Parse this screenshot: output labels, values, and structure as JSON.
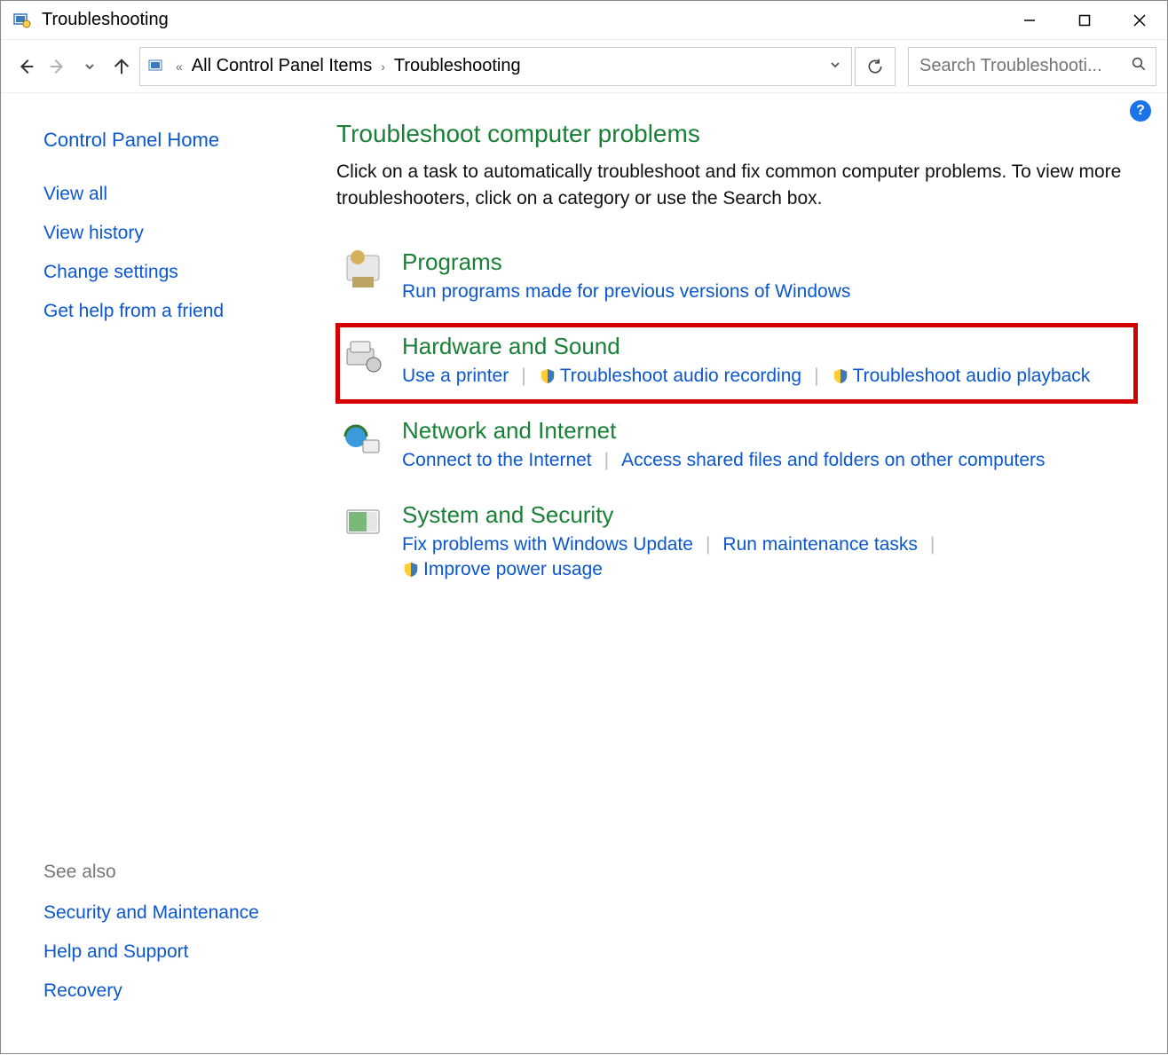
{
  "window": {
    "title": "Troubleshooting"
  },
  "breadcrumb": {
    "item1": "All Control Panel Items",
    "item2": "Troubleshooting"
  },
  "search": {
    "placeholder": "Search Troubleshooti..."
  },
  "sidebar": {
    "home": "Control Panel Home",
    "view_all": "View all",
    "view_history": "View history",
    "change_settings": "Change settings",
    "get_help": "Get help from a friend",
    "see_also_label": "See also",
    "security": "Security and Maintenance",
    "help_support": "Help and Support",
    "recovery": "Recovery"
  },
  "main": {
    "title": "Troubleshoot computer problems",
    "description": "Click on a task to automatically troubleshoot and fix common computer problems. To view more troubleshooters, click on a category or use the Search box."
  },
  "categories": {
    "programs": {
      "title": "Programs",
      "link1": "Run programs made for previous versions of Windows"
    },
    "hardware": {
      "title": "Hardware and Sound",
      "link1": "Use a printer",
      "link2": "Troubleshoot audio recording",
      "link3": "Troubleshoot audio playback"
    },
    "network": {
      "title": "Network and Internet",
      "link1": "Connect to the Internet",
      "link2": "Access shared files and folders on other computers"
    },
    "system": {
      "title": "System and Security",
      "link1": "Fix problems with Windows Update",
      "link2": "Run maintenance tasks",
      "link3": "Improve power usage"
    }
  }
}
